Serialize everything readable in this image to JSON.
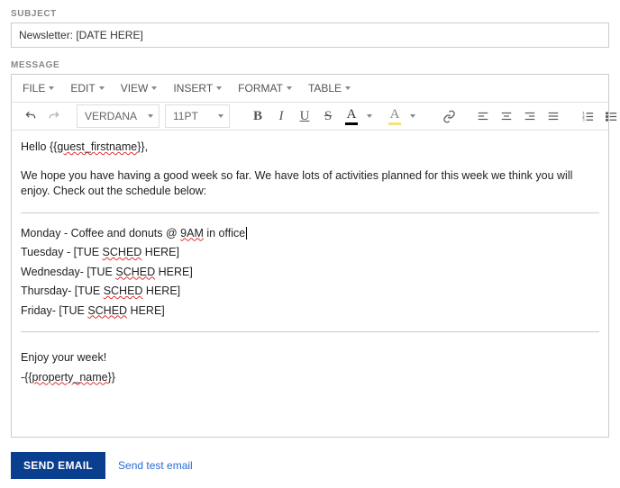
{
  "labels": {
    "subject": "SUBJECT",
    "message": "MESSAGE"
  },
  "subject_value": "Newsletter: [DATE HERE]",
  "menubar": {
    "file": "FILE",
    "edit": "EDIT",
    "view": "VIEW",
    "insert": "INSERT",
    "format": "FORMAT",
    "table": "TABLE"
  },
  "toolbar": {
    "font_family": "VERDANA",
    "font_size": "11PT"
  },
  "body": {
    "greeting_prefix": "Hello {{",
    "greeting_name_sq": "guest_firstname",
    "greeting_suffix": "}},",
    "para1": "We hope you have having a good week so far. We have lots of activities planned for this week we think you will enjoy. Check out the schedule below:",
    "mon_prefix": "Monday - Coffee and donuts @ ",
    "mon_sq": "9AM",
    "mon_suffix": " in office",
    "tue_prefix": "Tuesday - [TUE ",
    "tue_sq": "SCHED",
    "tue_suffix": " HERE]",
    "wed_prefix": "Wednesday- [TUE ",
    "wed_sq": "SCHED",
    "wed_suffix": " HERE]",
    "thu_prefix": "Thursday- [TUE ",
    "thu_sq": "SCHED",
    "thu_suffix": " HERE]",
    "fri_prefix": "Friday- [TUE ",
    "fri_sq": "SCHED",
    "fri_suffix": " HERE]",
    "closing1": "Enjoy your week!",
    "closing2_prefix": "-{{",
    "closing2_sq": "property_name",
    "closing2_suffix": "}}"
  },
  "actions": {
    "send": "SEND EMAIL",
    "send_test": "Send test email"
  }
}
